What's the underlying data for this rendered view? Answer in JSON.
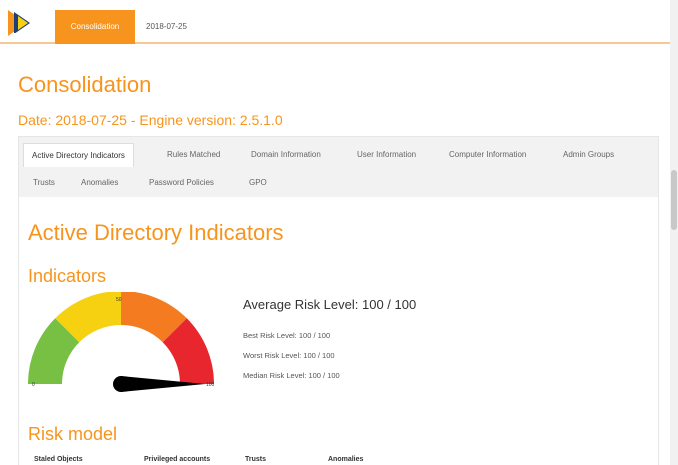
{
  "navbar": {
    "logo_icon": "pingcastle-logo-icon",
    "active_tab": "Consolidation",
    "date_tab": "2018-07-25"
  },
  "header": {
    "title": "Consolidation",
    "subtitle": "Date: 2018-07-25 - Engine version: 2.5.1.0"
  },
  "tabs": [
    "Active Directory Indicators",
    "Rules Matched",
    "Domain Information",
    "User Information",
    "Computer Information",
    "Admin Groups",
    "Trusts",
    "Anomalies",
    "Password Policies",
    "GPO"
  ],
  "content": {
    "section_title": "Active Directory Indicators",
    "indicators_title": "Indicators",
    "gauge": {
      "min_label": "0",
      "mid_label": "50",
      "max_label": "100",
      "value": 100,
      "colors": [
        "#77c043",
        "#f6d112",
        "#f47b20",
        "#e8262e"
      ]
    },
    "average": "Average Risk Level: 100 / 100",
    "best": "Best Risk Level: 100 / 100",
    "worst": "Worst Risk Level: 100 / 100",
    "median": "Median Risk Level: 100 / 100",
    "risk_model_title": "Risk model",
    "risk_model_columns": [
      "Staled Objects",
      "Privileged accounts",
      "Trusts",
      "Anomalies"
    ]
  },
  "colors": {
    "accent": "#f7941d"
  }
}
